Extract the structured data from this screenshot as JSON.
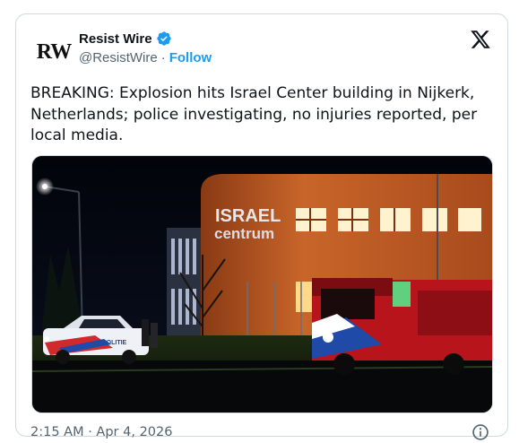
{
  "author": {
    "avatar_text": "RW",
    "display_name": "Resist Wire",
    "handle": "@ResistWire",
    "separator": "·",
    "follow_label": "Follow",
    "verified": true
  },
  "tweet": {
    "text": "BREAKING: Explosion hits Israel Center building in Nijkerk, Netherlands; police investigating, no injuries reported, per local media."
  },
  "media": {
    "sign_line1": "ISRAEL",
    "sign_line2": "centrum",
    "vehicle_text": "POLITIE"
  },
  "meta": {
    "timestamp": "2:15 AM · Apr 4, 2026"
  },
  "colors": {
    "link": "#1d9bf0",
    "secondary_text": "#536471",
    "border": "#cfd9de",
    "verified_badge": "#1d9bf0"
  },
  "icons": {
    "brand": "x-logo-icon",
    "verified": "verified-badge-icon",
    "info": "info-icon"
  }
}
